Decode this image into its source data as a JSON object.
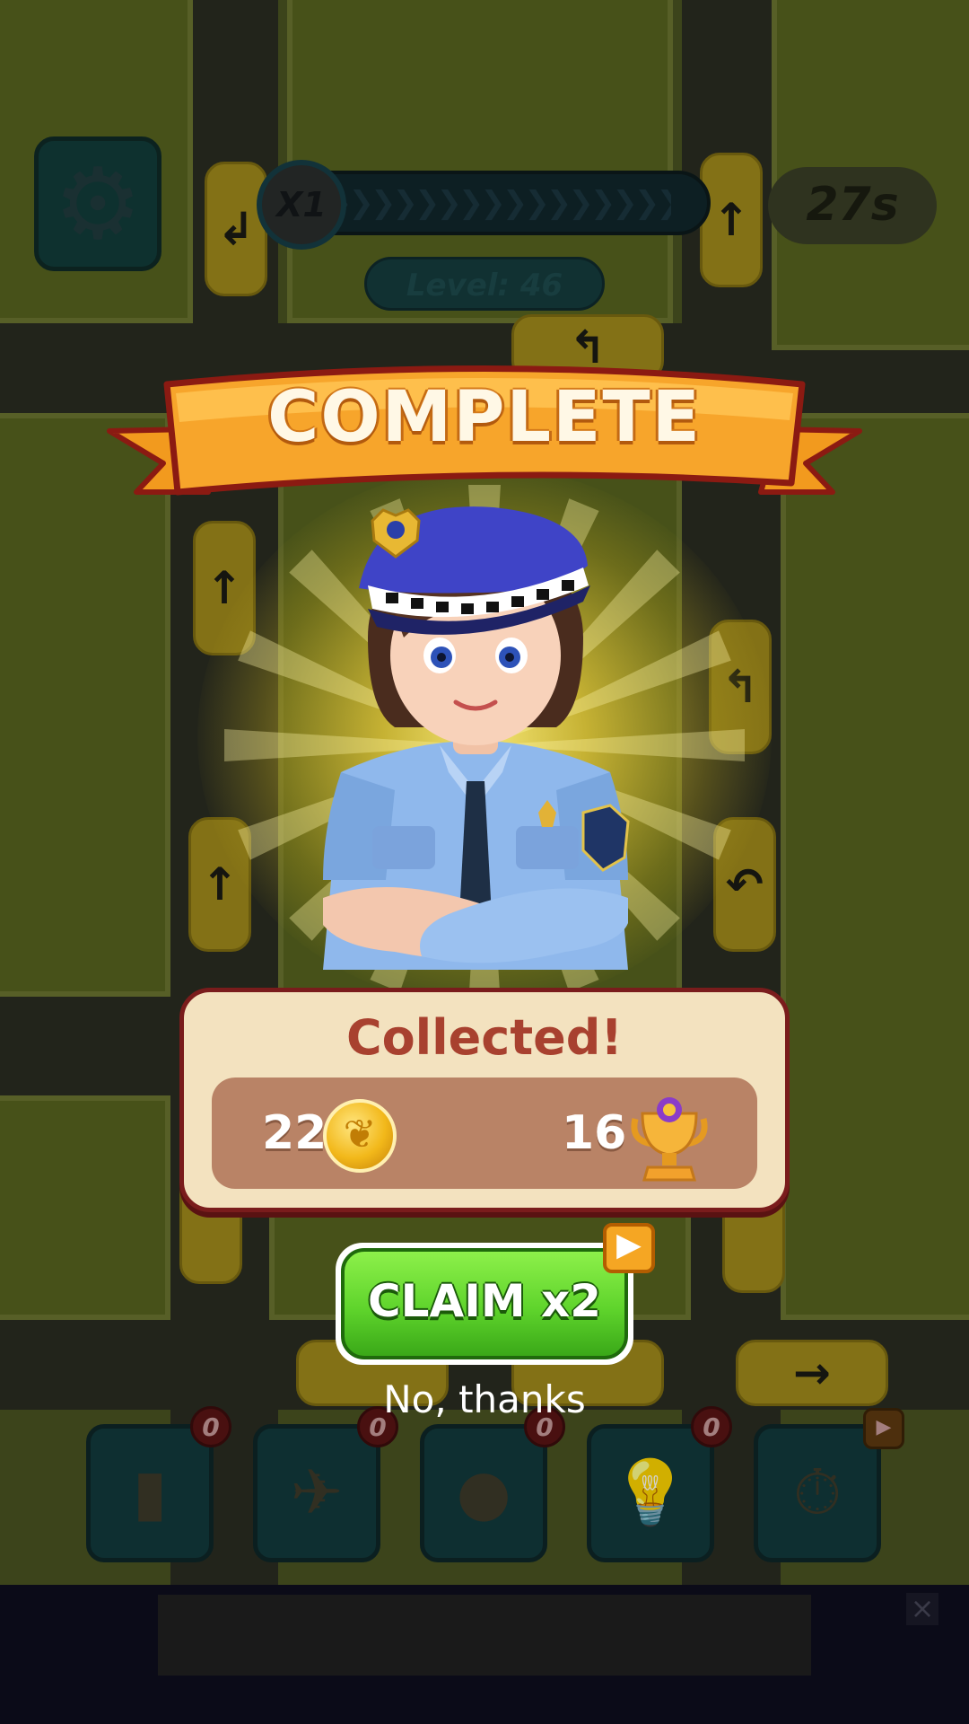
{
  "hud": {
    "multiplier": "X1",
    "timer": "27s",
    "level_label": "Level: 46"
  },
  "popup": {
    "banner_title": "COMPLETE",
    "card_title": "Collected!",
    "rewards": [
      {
        "amount": "22",
        "icon": "gold-coin-icon"
      },
      {
        "amount": "16",
        "icon": "trophy-icon"
      }
    ],
    "claim_label": "CLAIM x2",
    "claim_ad_icon": "play-ad-icon",
    "decline_label": "No, thanks"
  },
  "boosters": [
    {
      "icon": "battery-icon",
      "count": "0"
    },
    {
      "icon": "plane-icon",
      "count": "0"
    },
    {
      "icon": "bomb-icon",
      "count": "0"
    },
    {
      "icon": "lightbulb-icon",
      "count": "0"
    },
    {
      "icon": "stopwatch-icon",
      "count": "play-ad"
    }
  ],
  "colors": {
    "banner": "#f6a12a",
    "claim_green": "#5fd42c",
    "card_bg": "#f3e2bf",
    "card_title": "#a8412f"
  }
}
